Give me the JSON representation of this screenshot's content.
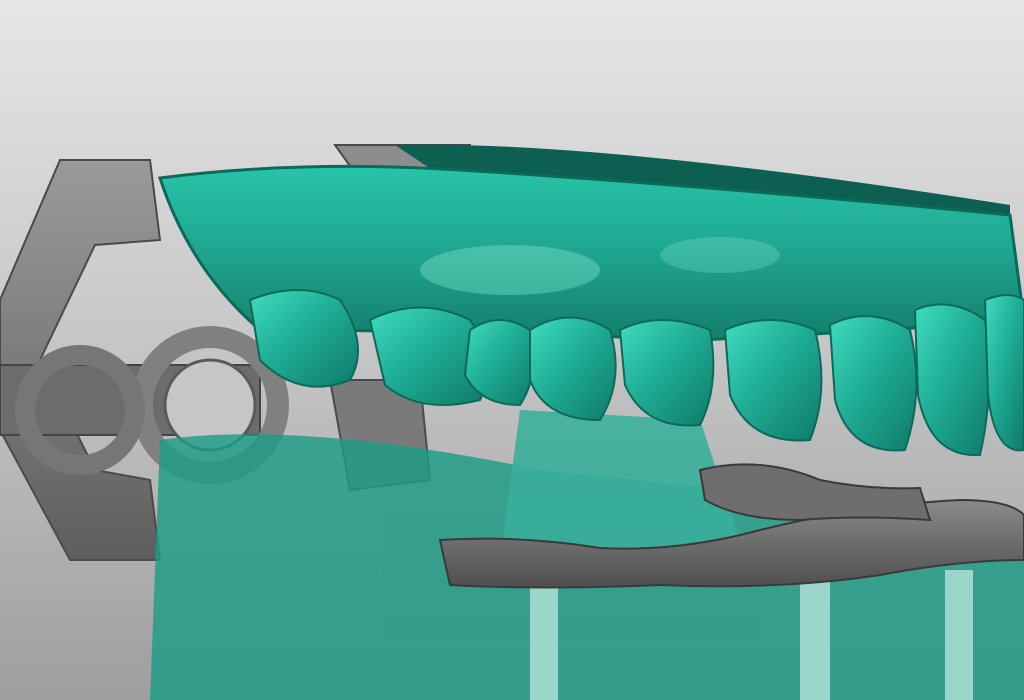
{
  "viewport": {
    "background_top": "#e6e6e6",
    "background_bottom": "#9e9e9e"
  },
  "colors": {
    "model_teal": "#1fa58f",
    "model_teal_dark": "#0d6a5a",
    "model_highlight": "#8ff0dc",
    "articulator_gray": "#7c7c7c",
    "articulator_dark": "#555555",
    "gingiva_scan": "#6f6f6f"
  },
  "scene": {
    "objects": [
      "articulator-frame",
      "upper-jaw-model",
      "lower-jaw-model-transparent",
      "lower-gingiva-scan",
      "implant-analogs"
    ],
    "upper_teeth_count": 9,
    "implant_count": 3
  }
}
